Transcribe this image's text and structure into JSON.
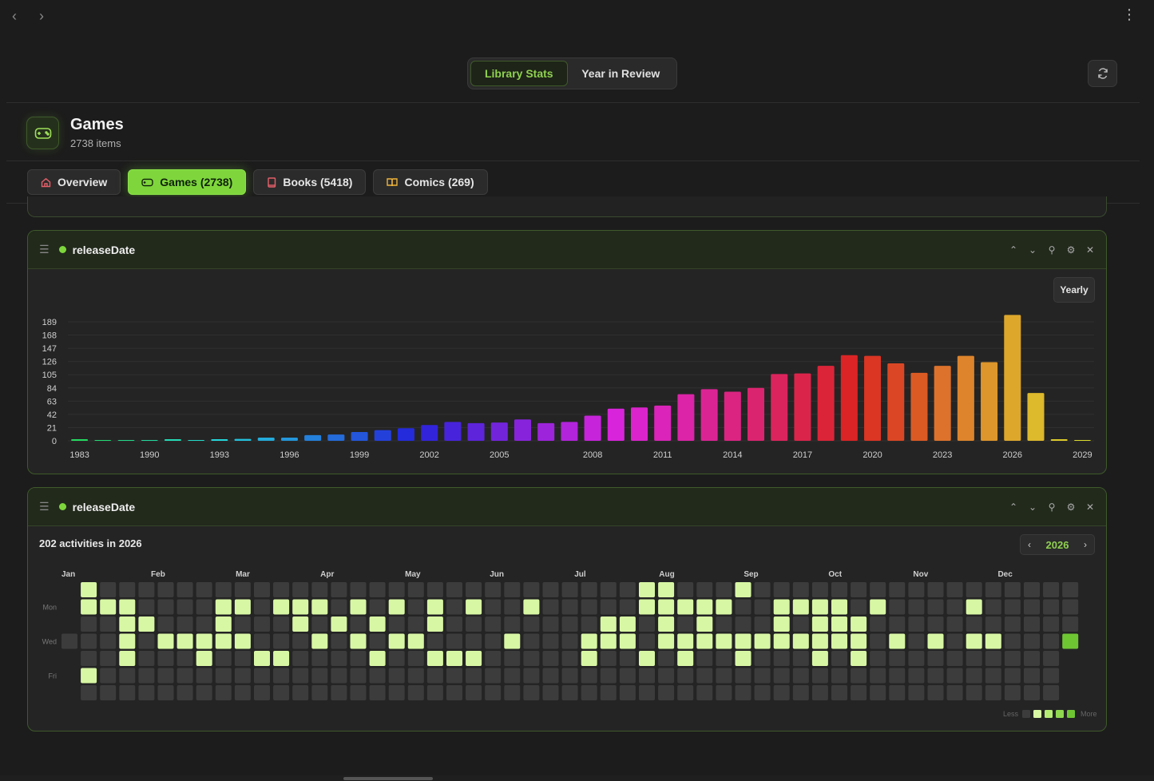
{
  "nav": {
    "back_icon": "chevron-left-icon",
    "forward_icon": "chevron-right-icon",
    "menu_icon": "kebab-menu-icon"
  },
  "view_toggle": {
    "library_stats": "Library Stats",
    "year_in_review": "Year in Review"
  },
  "refresh_icon": "refresh-icon",
  "library": {
    "title": "Games",
    "count_label": "2738 items",
    "icon": "gamepad-icon"
  },
  "tabs": [
    {
      "label": "Overview",
      "icon": "home-icon",
      "active": false
    },
    {
      "label": "Games (2738)",
      "icon": "gamepad-icon",
      "active": true
    },
    {
      "label": "Books (5418)",
      "icon": "book-icon",
      "active": false
    },
    {
      "label": "Comics (269)",
      "icon": "open-book-icon",
      "active": false
    }
  ],
  "panels": {
    "bar": {
      "title": "releaseDate",
      "period_button": "Yearly"
    },
    "heatmap": {
      "title": "releaseDate",
      "summary": "202 activities in 2026",
      "year": "2026",
      "months": [
        "Jan",
        "Feb",
        "Mar",
        "Apr",
        "May",
        "Jun",
        "Jul",
        "Aug",
        "Sep",
        "Oct",
        "Nov",
        "Dec"
      ],
      "day_labels": [
        "Mon",
        "Wed",
        "Fri"
      ],
      "legend_less": "Less",
      "legend_more": "More"
    }
  },
  "chart_data": [
    {
      "type": "bar",
      "title": "",
      "xlabel": "",
      "ylabel": "",
      "ylim": [
        0,
        189
      ],
      "y_ticks": [
        0,
        21,
        42,
        63,
        84,
        105,
        126,
        147,
        168,
        189
      ],
      "x_tick_labels": [
        "1983",
        "1990",
        "1993",
        "1996",
        "1999",
        "2002",
        "2005",
        "2008",
        "2011",
        "2014",
        "2017",
        "2020",
        "2023",
        "2026",
        "2029"
      ],
      "categories": [
        "1983",
        "1990",
        "1991",
        "1992",
        "1993",
        "1994",
        "1995",
        "1996",
        "1997",
        "1998",
        "1999",
        "2000",
        "2001",
        "2002",
        "2003",
        "2004",
        "2005",
        "2006",
        "2007",
        "2008",
        "2009",
        "2010",
        "2011",
        "2012",
        "2013",
        "2014",
        "2015",
        "2016",
        "2017",
        "2018",
        "2019",
        "2020",
        "2021",
        "2022",
        "2023",
        "2024",
        "2025",
        "2026",
        "2027",
        "2028",
        "2029"
      ],
      "values": [
        1,
        0,
        0,
        0,
        2,
        0,
        2,
        3,
        5,
        5,
        9,
        10,
        14,
        17,
        20,
        25,
        30,
        28,
        29,
        34,
        28,
        30,
        40,
        51,
        53,
        56,
        74,
        82,
        78,
        84,
        106,
        107,
        119,
        136,
        135,
        123,
        108,
        119,
        135,
        125,
        200,
        76,
        2,
        0
      ],
      "grid": true
    },
    {
      "type": "heatmap",
      "title": "202 activities in 2026",
      "year": 2026,
      "rows": 7,
      "columns": 53,
      "active_days": [
        [
          1,
          0
        ],
        [
          0,
          1
        ],
        [
          1,
          1
        ],
        [
          2,
          3
        ],
        [
          3,
          3
        ],
        [
          4,
          3
        ],
        [
          5,
          1
        ],
        [
          1,
          2
        ],
        [
          2,
          4
        ],
        [
          3,
          5
        ],
        [
          3,
          6
        ],
        [
          1,
          3
        ],
        [
          3,
          7
        ],
        [
          3,
          8
        ],
        [
          1,
          8
        ],
        [
          2,
          8
        ],
        [
          4,
          7
        ],
        [
          3,
          9
        ],
        [
          1,
          9
        ],
        [
          4,
          10
        ],
        [
          4,
          11
        ],
        [
          1,
          11
        ],
        [
          1,
          12
        ],
        [
          2,
          12
        ],
        [
          3,
          13
        ],
        [
          1,
          13
        ],
        [
          2,
          14
        ],
        [
          3,
          15
        ],
        [
          1,
          15
        ],
        [
          4,
          16
        ],
        [
          2,
          16
        ],
        [
          3,
          17
        ],
        [
          1,
          17
        ],
        [
          3,
          18
        ],
        [
          1,
          19
        ],
        [
          2,
          19
        ],
        [
          4,
          19
        ],
        [
          4,
          20
        ],
        [
          4,
          21
        ],
        [
          1,
          21
        ],
        [
          3,
          23
        ],
        [
          1,
          24
        ],
        [
          3,
          27
        ],
        [
          4,
          27
        ],
        [
          3,
          28
        ],
        [
          2,
          28
        ],
        [
          2,
          29
        ],
        [
          3,
          29
        ],
        [
          1,
          30
        ],
        [
          0,
          30
        ],
        [
          1,
          31
        ],
        [
          0,
          31
        ],
        [
          2,
          31
        ],
        [
          3,
          31
        ],
        [
          4,
          30
        ],
        [
          1,
          32
        ],
        [
          3,
          32
        ],
        [
          4,
          32
        ],
        [
          3,
          33
        ],
        [
          1,
          33
        ],
        [
          2,
          33
        ],
        [
          3,
          34
        ],
        [
          1,
          34
        ],
        [
          0,
          35
        ],
        [
          3,
          35
        ],
        [
          4,
          35
        ],
        [
          3,
          36
        ],
        [
          1,
          37
        ],
        [
          2,
          37
        ],
        [
          3,
          37
        ],
        [
          3,
          38
        ],
        [
          1,
          38
        ],
        [
          4,
          39
        ],
        [
          2,
          39
        ],
        [
          3,
          39
        ],
        [
          1,
          39
        ],
        [
          1,
          40
        ],
        [
          2,
          40
        ],
        [
          3,
          40
        ],
        [
          3,
          41
        ],
        [
          4,
          41
        ],
        [
          2,
          41
        ],
        [
          1,
          42
        ],
        [
          3,
          43
        ],
        [
          3,
          45
        ],
        [
          1,
          47
        ],
        [
          3,
          47
        ],
        [
          3,
          48
        ],
        [
          3,
          52
        ]
      ],
      "max_day": [
        3,
        52
      ]
    }
  ]
}
